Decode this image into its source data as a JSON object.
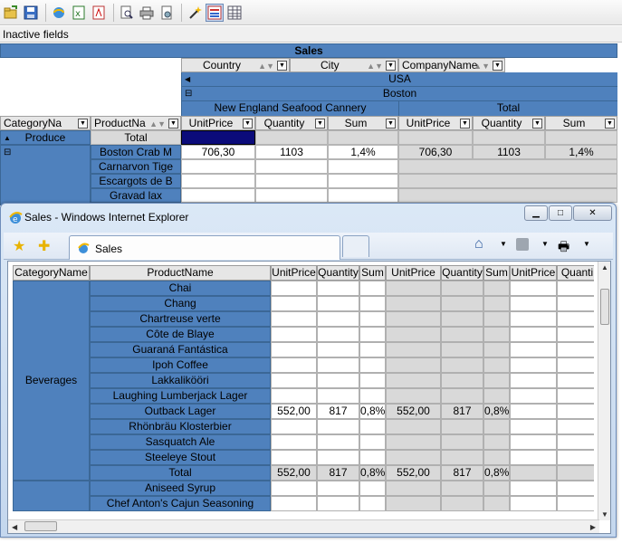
{
  "toolbar": {
    "icons": [
      "open-icon",
      "save-icon",
      "export-html-icon",
      "export-excel-icon",
      "export-pdf-icon",
      "print-preview-icon",
      "print-icon",
      "page-setup-icon",
      "wand-icon",
      "pivot-view-icon",
      "grid-view-icon"
    ]
  },
  "inactive_fields": "Inactive fields",
  "pivot": {
    "title": "Sales",
    "column_fields": [
      "Country",
      "City",
      "CompanyName"
    ],
    "country": "USA",
    "city": "Boston",
    "company": "New England Seafood Cannery",
    "total_label": "Total",
    "row_fields": [
      "CategoryNa",
      "ProductNa"
    ],
    "measures": [
      "UnitPrice",
      "Quantity",
      "Sum",
      "UnitPrice",
      "Quantity",
      "Sum"
    ],
    "category": "Produce",
    "category_total": "Total",
    "products": [
      "Boston Crab M",
      "Carnarvon Tige",
      "Escargots de B",
      "Gravad lax"
    ],
    "row1_values": [
      "706,30",
      "1103",
      "1,4%",
      "706,30",
      "1103",
      "1,4%"
    ]
  },
  "ie": {
    "title": "Sales - Windows Internet Explorer",
    "tab_label": "Sales",
    "grid": {
      "headers": [
        "CategoryName",
        "ProductName",
        "UnitPrice",
        "Quantity",
        "Sum",
        "UnitPrice",
        "Quantity",
        "Sum",
        "UnitPrice",
        "Quanti"
      ],
      "category": "Beverages",
      "products": [
        "Chai",
        "Chang",
        "Chartreuse verte",
        "Côte de Blaye",
        "Guaraná Fantástica",
        "Ipoh Coffee",
        "Lakkalikööri",
        "Laughing Lumberjack Lager",
        "Outback Lager",
        "Rhönbräu Klosterbier",
        "Sasquatch Ale",
        "Steeleye Stout",
        "Total",
        "Aniseed Syrup",
        "Chef Anton's Cajun Seasoning"
      ],
      "outback_values": [
        "552,00",
        "817",
        "0,8%",
        "552,00",
        "817",
        "0,8%"
      ],
      "total_values": [
        "552,00",
        "817",
        "0,8%",
        "552,00",
        "817",
        "0,8%"
      ]
    }
  }
}
